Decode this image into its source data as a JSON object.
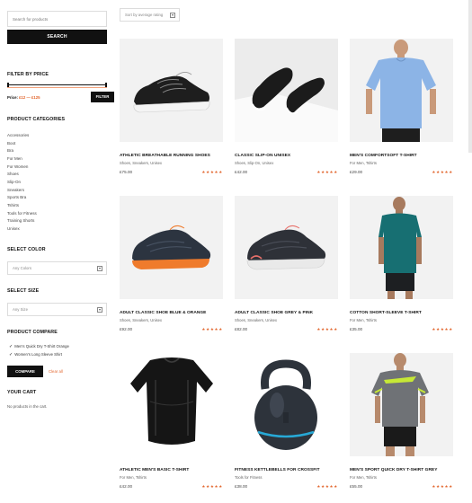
{
  "search": {
    "placeholder": "Search for products",
    "button": "SEARCH"
  },
  "filter_price": {
    "title": "FILTER BY PRICE",
    "label_prefix": "Price:",
    "range": "£12 — £125",
    "button": "FILTER"
  },
  "categories": {
    "title": "PRODUCT CATEGORIES",
    "items": [
      "Accessories",
      "Boot",
      "Bra",
      "For Men",
      "For Women",
      "Shoes",
      "Slip-On",
      "Sneakers",
      "Sports Bra",
      "Tshirts",
      "Tools for Fitness",
      "Training Shorts",
      "Unisex"
    ]
  },
  "color": {
    "title": "SELECT COLOR",
    "value": "Any Colors"
  },
  "size": {
    "title": "SELECT SIZE",
    "value": "Any Size"
  },
  "compare": {
    "title": "PRODUCT COMPARE",
    "items": [
      "Men's Quick Dry T-Shirt Orange",
      "Women's Long Sleeve Shirt"
    ],
    "button": "COMPARE",
    "clear": "Clear all"
  },
  "cart": {
    "title": "YOUR CART",
    "empty": "No products in the cart."
  },
  "sort": {
    "value": "Sort by average rating"
  },
  "colors": {
    "accent": "#e2652c",
    "dark": "#111111"
  },
  "products": [
    {
      "title": "ATHLETIC BREATHABLE RUNNING SHOES",
      "cats": "Shoes, Sneakers, Unisex",
      "price": "£75.00",
      "stars": "★★★★★",
      "image": "black-sneaker"
    },
    {
      "title": "CLASSIC SLIP-ON UNISEX",
      "cats": "Shoes, Slip-On, Unisex",
      "price": "£42.00",
      "stars": "★★★★★",
      "image": "slip-on-shoes"
    },
    {
      "title": "MEN'S COMFORTSOFT T-SHIRT",
      "cats": "For Men, Tshirts",
      "price": "£29.00",
      "stars": "★★★★★",
      "image": "blue-tshirt-model"
    },
    {
      "title": "ADULT CLASSIC SHOE BLUE & ORANGE",
      "cats": "Shoes, Sneakers, Unisex",
      "price": "£92.00",
      "stars": "★★★★★",
      "image": "orange-sole-shoe"
    },
    {
      "title": "ADULT CLASSIC SHOE GREY & PINK",
      "cats": "Shoes, Sneakers, Unisex",
      "price": "£82.00",
      "stars": "★★★★★",
      "image": "pink-sole-shoe"
    },
    {
      "title": "COTTON SHORT-SLEEVE T-SHIRT",
      "cats": "For Men, Tshirts",
      "price": "£35.00",
      "stars": "★★★★★",
      "image": "teal-tshirt-model"
    },
    {
      "title": "ATHLETIC MEN'S BASIC T-SHIRT",
      "cats": "For Men, Tshirts",
      "price": "£42.00",
      "stars": "★★★★★",
      "image": "black-compression-shirt"
    },
    {
      "title": "FITNESS KETTLEBELLS FOR CROSSFIT",
      "cats": "Tools for Fitness",
      "price": "£38.00",
      "stars": "★★★★★",
      "image": "kettlebell"
    },
    {
      "title": "MEN'S SPORT QUICK DRY T-SHIRT GREY",
      "cats": "For Men, Tshirts",
      "price": "£55.00",
      "stars": "★★★★★",
      "image": "grey-tshirt-model"
    }
  ]
}
